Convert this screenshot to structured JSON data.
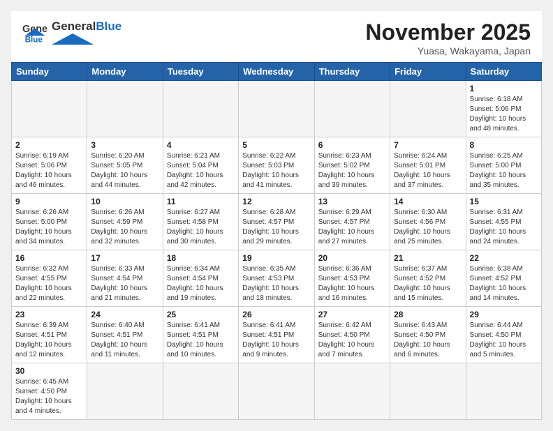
{
  "header": {
    "logo_general": "General",
    "logo_blue": "Blue",
    "month_title": "November 2025",
    "location": "Yuasa, Wakayama, Japan"
  },
  "days_of_week": [
    "Sunday",
    "Monday",
    "Tuesday",
    "Wednesday",
    "Thursday",
    "Friday",
    "Saturday"
  ],
  "weeks": [
    [
      {
        "day": "",
        "info": ""
      },
      {
        "day": "",
        "info": ""
      },
      {
        "day": "",
        "info": ""
      },
      {
        "day": "",
        "info": ""
      },
      {
        "day": "",
        "info": ""
      },
      {
        "day": "",
        "info": ""
      },
      {
        "day": "1",
        "info": "Sunrise: 6:18 AM\nSunset: 5:06 PM\nDaylight: 10 hours and 48 minutes."
      }
    ],
    [
      {
        "day": "2",
        "info": "Sunrise: 6:19 AM\nSunset: 5:06 PM\nDaylight: 10 hours and 46 minutes."
      },
      {
        "day": "3",
        "info": "Sunrise: 6:20 AM\nSunset: 5:05 PM\nDaylight: 10 hours and 44 minutes."
      },
      {
        "day": "4",
        "info": "Sunrise: 6:21 AM\nSunset: 5:04 PM\nDaylight: 10 hours and 42 minutes."
      },
      {
        "day": "5",
        "info": "Sunrise: 6:22 AM\nSunset: 5:03 PM\nDaylight: 10 hours and 41 minutes."
      },
      {
        "day": "6",
        "info": "Sunrise: 6:23 AM\nSunset: 5:02 PM\nDaylight: 10 hours and 39 minutes."
      },
      {
        "day": "7",
        "info": "Sunrise: 6:24 AM\nSunset: 5:01 PM\nDaylight: 10 hours and 37 minutes."
      },
      {
        "day": "8",
        "info": "Sunrise: 6:25 AM\nSunset: 5:00 PM\nDaylight: 10 hours and 35 minutes."
      }
    ],
    [
      {
        "day": "9",
        "info": "Sunrise: 6:26 AM\nSunset: 5:00 PM\nDaylight: 10 hours and 34 minutes."
      },
      {
        "day": "10",
        "info": "Sunrise: 6:26 AM\nSunset: 4:59 PM\nDaylight: 10 hours and 32 minutes."
      },
      {
        "day": "11",
        "info": "Sunrise: 6:27 AM\nSunset: 4:58 PM\nDaylight: 10 hours and 30 minutes."
      },
      {
        "day": "12",
        "info": "Sunrise: 6:28 AM\nSunset: 4:57 PM\nDaylight: 10 hours and 29 minutes."
      },
      {
        "day": "13",
        "info": "Sunrise: 6:29 AM\nSunset: 4:57 PM\nDaylight: 10 hours and 27 minutes."
      },
      {
        "day": "14",
        "info": "Sunrise: 6:30 AM\nSunset: 4:56 PM\nDaylight: 10 hours and 25 minutes."
      },
      {
        "day": "15",
        "info": "Sunrise: 6:31 AM\nSunset: 4:55 PM\nDaylight: 10 hours and 24 minutes."
      }
    ],
    [
      {
        "day": "16",
        "info": "Sunrise: 6:32 AM\nSunset: 4:55 PM\nDaylight: 10 hours and 22 minutes."
      },
      {
        "day": "17",
        "info": "Sunrise: 6:33 AM\nSunset: 4:54 PM\nDaylight: 10 hours and 21 minutes."
      },
      {
        "day": "18",
        "info": "Sunrise: 6:34 AM\nSunset: 4:54 PM\nDaylight: 10 hours and 19 minutes."
      },
      {
        "day": "19",
        "info": "Sunrise: 6:35 AM\nSunset: 4:53 PM\nDaylight: 10 hours and 18 minutes."
      },
      {
        "day": "20",
        "info": "Sunrise: 6:36 AM\nSunset: 4:53 PM\nDaylight: 10 hours and 16 minutes."
      },
      {
        "day": "21",
        "info": "Sunrise: 6:37 AM\nSunset: 4:52 PM\nDaylight: 10 hours and 15 minutes."
      },
      {
        "day": "22",
        "info": "Sunrise: 6:38 AM\nSunset: 4:52 PM\nDaylight: 10 hours and 14 minutes."
      }
    ],
    [
      {
        "day": "23",
        "info": "Sunrise: 6:39 AM\nSunset: 4:51 PM\nDaylight: 10 hours and 12 minutes."
      },
      {
        "day": "24",
        "info": "Sunrise: 6:40 AM\nSunset: 4:51 PM\nDaylight: 10 hours and 11 minutes."
      },
      {
        "day": "25",
        "info": "Sunrise: 6:41 AM\nSunset: 4:51 PM\nDaylight: 10 hours and 10 minutes."
      },
      {
        "day": "26",
        "info": "Sunrise: 6:41 AM\nSunset: 4:51 PM\nDaylight: 10 hours and 9 minutes."
      },
      {
        "day": "27",
        "info": "Sunrise: 6:42 AM\nSunset: 4:50 PM\nDaylight: 10 hours and 7 minutes."
      },
      {
        "day": "28",
        "info": "Sunrise: 6:43 AM\nSunset: 4:50 PM\nDaylight: 10 hours and 6 minutes."
      },
      {
        "day": "29",
        "info": "Sunrise: 6:44 AM\nSunset: 4:50 PM\nDaylight: 10 hours and 5 minutes."
      }
    ],
    [
      {
        "day": "30",
        "info": "Sunrise: 6:45 AM\nSunset: 4:50 PM\nDaylight: 10 hours and 4 minutes."
      },
      {
        "day": "",
        "info": ""
      },
      {
        "day": "",
        "info": ""
      },
      {
        "day": "",
        "info": ""
      },
      {
        "day": "",
        "info": ""
      },
      {
        "day": "",
        "info": ""
      },
      {
        "day": "",
        "info": ""
      }
    ]
  ]
}
